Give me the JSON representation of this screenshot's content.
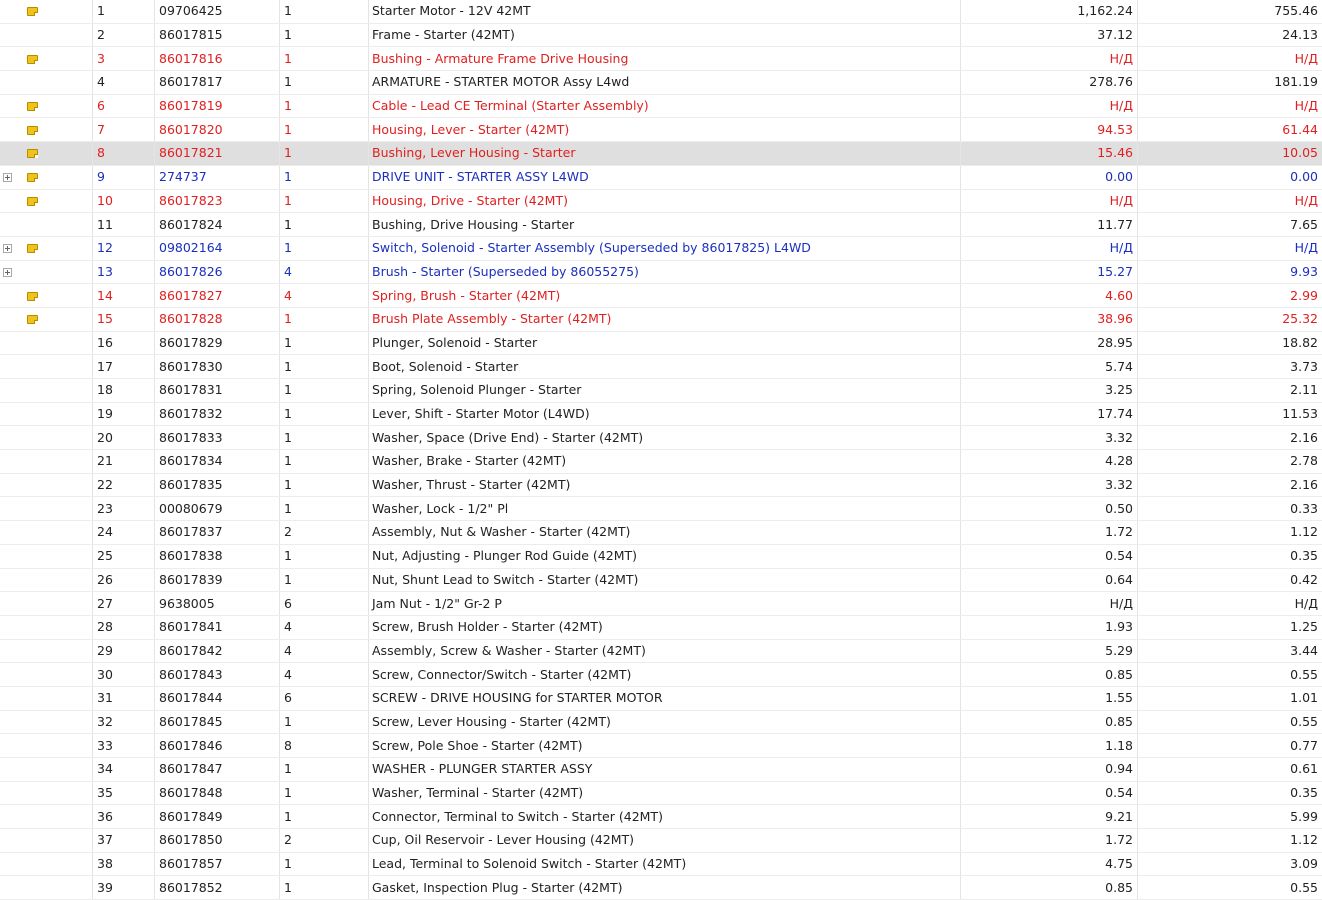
{
  "colors": {
    "unavailable": "#e02020",
    "superseded": "#1a2fbf",
    "selected_row": "#dfdfdf"
  },
  "rows": [
    {
      "num": "1",
      "pn": "09706425",
      "qty": "1",
      "desc": "Starter Motor - 12V 42MT",
      "p1": "1,162.24",
      "p2": "755.46",
      "note": true,
      "expand": false,
      "state": "normal"
    },
    {
      "num": "2",
      "pn": "86017815",
      "qty": "1",
      "desc": "Frame - Starter (42MT)",
      "p1": "37.12",
      "p2": "24.13",
      "note": false,
      "expand": false,
      "state": "normal"
    },
    {
      "num": "3",
      "pn": "86017816",
      "qty": "1",
      "desc": "Bushing - Armature Frame Drive Housing",
      "p1": "Н/Д",
      "p2": "Н/Д",
      "note": true,
      "expand": false,
      "state": "red"
    },
    {
      "num": "4",
      "pn": "86017817",
      "qty": "1",
      "desc": "ARMATURE - STARTER MOTOR Assy L4wd",
      "p1": "278.76",
      "p2": "181.19",
      "note": false,
      "expand": false,
      "state": "normal"
    },
    {
      "num": "6",
      "pn": "86017819",
      "qty": "1",
      "desc": "Cable - Lead CE Terminal (Starter Assembly)",
      "p1": "Н/Д",
      "p2": "Н/Д",
      "note": true,
      "expand": false,
      "state": "red"
    },
    {
      "num": "7",
      "pn": "86017820",
      "qty": "1",
      "desc": "Housing, Lever - Starter (42MT)",
      "p1": "94.53",
      "p2": "61.44",
      "note": true,
      "expand": false,
      "state": "red"
    },
    {
      "num": "8",
      "pn": "86017821",
      "qty": "1",
      "desc": "Bushing, Lever Housing - Starter",
      "p1": "15.46",
      "p2": "10.05",
      "note": true,
      "expand": false,
      "state": "red",
      "selected": true
    },
    {
      "num": "9",
      "pn": "274737",
      "qty": "1",
      "desc": "DRIVE UNIT - STARTER ASSY L4WD",
      "p1": "0.00",
      "p2": "0.00",
      "note": true,
      "expand": true,
      "state": "blue"
    },
    {
      "num": "10",
      "pn": "86017823",
      "qty": "1",
      "desc": "Housing, Drive - Starter (42MT)",
      "p1": "Н/Д",
      "p2": "Н/Д",
      "note": true,
      "expand": false,
      "state": "red"
    },
    {
      "num": "11",
      "pn": "86017824",
      "qty": "1",
      "desc": "Bushing, Drive Housing - Starter",
      "p1": "11.77",
      "p2": "7.65",
      "note": false,
      "expand": false,
      "state": "normal"
    },
    {
      "num": "12",
      "pn": "09802164",
      "qty": "1",
      "desc": "Switch, Solenoid - Starter Assembly (Superseded by 86017825) L4WD",
      "p1": "Н/Д",
      "p2": "Н/Д",
      "note": true,
      "expand": true,
      "state": "blue"
    },
    {
      "num": "13",
      "pn": "86017826",
      "qty": "4",
      "desc": "Brush - Starter (Superseded by 86055275)",
      "p1": "15.27",
      "p2": "9.93",
      "note": false,
      "expand": true,
      "state": "blue"
    },
    {
      "num": "14",
      "pn": "86017827",
      "qty": "4",
      "desc": "Spring, Brush - Starter (42MT)",
      "p1": "4.60",
      "p2": "2.99",
      "note": true,
      "expand": false,
      "state": "red"
    },
    {
      "num": "15",
      "pn": "86017828",
      "qty": "1",
      "desc": "Brush Plate Assembly - Starter (42MT)",
      "p1": "38.96",
      "p2": "25.32",
      "note": true,
      "expand": false,
      "state": "red"
    },
    {
      "num": "16",
      "pn": "86017829",
      "qty": "1",
      "desc": "Plunger, Solenoid - Starter",
      "p1": "28.95",
      "p2": "18.82",
      "note": false,
      "expand": false,
      "state": "normal"
    },
    {
      "num": "17",
      "pn": "86017830",
      "qty": "1",
      "desc": "Boot, Solenoid - Starter",
      "p1": "5.74",
      "p2": "3.73",
      "note": false,
      "expand": false,
      "state": "normal"
    },
    {
      "num": "18",
      "pn": "86017831",
      "qty": "1",
      "desc": "Spring, Solenoid Plunger - Starter",
      "p1": "3.25",
      "p2": "2.11",
      "note": false,
      "expand": false,
      "state": "normal"
    },
    {
      "num": "19",
      "pn": "86017832",
      "qty": "1",
      "desc": "Lever, Shift - Starter Motor (L4WD)",
      "p1": "17.74",
      "p2": "11.53",
      "note": false,
      "expand": false,
      "state": "normal"
    },
    {
      "num": "20",
      "pn": "86017833",
      "qty": "1",
      "desc": "Washer, Space (Drive End) - Starter (42MT)",
      "p1": "3.32",
      "p2": "2.16",
      "note": false,
      "expand": false,
      "state": "normal"
    },
    {
      "num": "21",
      "pn": "86017834",
      "qty": "1",
      "desc": "Washer, Brake - Starter (42MT)",
      "p1": "4.28",
      "p2": "2.78",
      "note": false,
      "expand": false,
      "state": "normal"
    },
    {
      "num": "22",
      "pn": "86017835",
      "qty": "1",
      "desc": "Washer, Thrust - Starter (42MT)",
      "p1": "3.32",
      "p2": "2.16",
      "note": false,
      "expand": false,
      "state": "normal"
    },
    {
      "num": "23",
      "pn": "00080679",
      "qty": "1",
      "desc": "Washer, Lock - 1/2\" Pl",
      "p1": "0.50",
      "p2": "0.33",
      "note": false,
      "expand": false,
      "state": "normal"
    },
    {
      "num": "24",
      "pn": "86017837",
      "qty": "2",
      "desc": "Assembly, Nut & Washer - Starter (42MT)",
      "p1": "1.72",
      "p2": "1.12",
      "note": false,
      "expand": false,
      "state": "normal"
    },
    {
      "num": "25",
      "pn": "86017838",
      "qty": "1",
      "desc": "Nut, Adjusting - Plunger Rod Guide (42MT)",
      "p1": "0.54",
      "p2": "0.35",
      "note": false,
      "expand": false,
      "state": "normal"
    },
    {
      "num": "26",
      "pn": "86017839",
      "qty": "1",
      "desc": "Nut, Shunt Lead to Switch - Starter (42MT)",
      "p1": "0.64",
      "p2": "0.42",
      "note": false,
      "expand": false,
      "state": "normal"
    },
    {
      "num": "27",
      "pn": "9638005",
      "qty": "6",
      "desc": "Jam Nut - 1/2\" Gr-2 P",
      "p1": "Н/Д",
      "p2": "Н/Д",
      "note": false,
      "expand": false,
      "state": "normal"
    },
    {
      "num": "28",
      "pn": "86017841",
      "qty": "4",
      "desc": "Screw, Brush Holder - Starter (42MT)",
      "p1": "1.93",
      "p2": "1.25",
      "note": false,
      "expand": false,
      "state": "normal"
    },
    {
      "num": "29",
      "pn": "86017842",
      "qty": "4",
      "desc": "Assembly, Screw & Washer - Starter (42MT)",
      "p1": "5.29",
      "p2": "3.44",
      "note": false,
      "expand": false,
      "state": "normal"
    },
    {
      "num": "30",
      "pn": "86017843",
      "qty": "4",
      "desc": "Screw, Connector/Switch - Starter (42MT)",
      "p1": "0.85",
      "p2": "0.55",
      "note": false,
      "expand": false,
      "state": "normal"
    },
    {
      "num": "31",
      "pn": "86017844",
      "qty": "6",
      "desc": "SCREW - DRIVE HOUSING for STARTER MOTOR",
      "p1": "1.55",
      "p2": "1.01",
      "note": false,
      "expand": false,
      "state": "normal"
    },
    {
      "num": "32",
      "pn": "86017845",
      "qty": "1",
      "desc": "Screw, Lever Housing - Starter (42MT)",
      "p1": "0.85",
      "p2": "0.55",
      "note": false,
      "expand": false,
      "state": "normal"
    },
    {
      "num": "33",
      "pn": "86017846",
      "qty": "8",
      "desc": "Screw, Pole Shoe - Starter (42MT)",
      "p1": "1.18",
      "p2": "0.77",
      "note": false,
      "expand": false,
      "state": "normal"
    },
    {
      "num": "34",
      "pn": "86017847",
      "qty": "1",
      "desc": "WASHER - PLUNGER STARTER ASSY",
      "p1": "0.94",
      "p2": "0.61",
      "note": false,
      "expand": false,
      "state": "normal"
    },
    {
      "num": "35",
      "pn": "86017848",
      "qty": "1",
      "desc": "Washer, Terminal - Starter (42MT)",
      "p1": "0.54",
      "p2": "0.35",
      "note": false,
      "expand": false,
      "state": "normal"
    },
    {
      "num": "36",
      "pn": "86017849",
      "qty": "1",
      "desc": "Connector, Terminal to Switch - Starter (42MT)",
      "p1": "9.21",
      "p2": "5.99",
      "note": false,
      "expand": false,
      "state": "normal"
    },
    {
      "num": "37",
      "pn": "86017850",
      "qty": "2",
      "desc": "Cup, Oil Reservoir - Lever Housing (42MT)",
      "p1": "1.72",
      "p2": "1.12",
      "note": false,
      "expand": false,
      "state": "normal"
    },
    {
      "num": "38",
      "pn": "86017857",
      "qty": "1",
      "desc": "Lead, Terminal to Solenoid Switch - Starter (42MT)",
      "p1": "4.75",
      "p2": "3.09",
      "note": false,
      "expand": false,
      "state": "normal"
    },
    {
      "num": "39",
      "pn": "86017852",
      "qty": "1",
      "desc": "Gasket, Inspection Plug - Starter (42MT)",
      "p1": "0.85",
      "p2": "0.55",
      "note": false,
      "expand": false,
      "state": "normal"
    }
  ]
}
